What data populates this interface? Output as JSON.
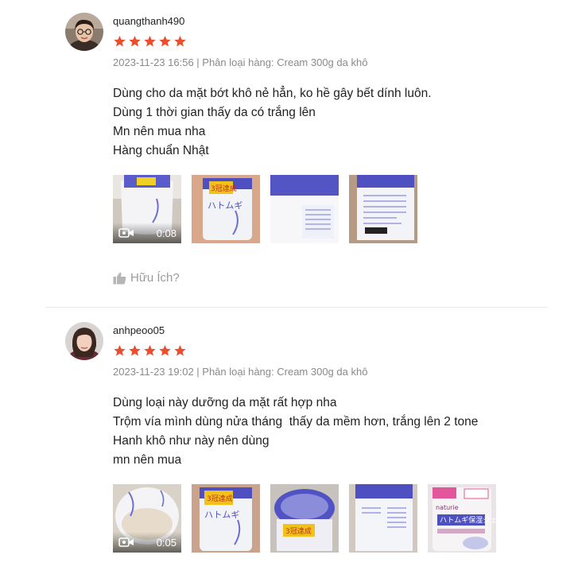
{
  "colors": {
    "star": "#ee4d2d",
    "meta": "#8a8a8a",
    "helpful": "#9a9a9a"
  },
  "reviews": [
    {
      "username": "quangthanh490",
      "rating": 5,
      "meta": "2023-11-23 16:56 | Phân loại hàng: Cream 300g da khô",
      "lines": [
        "Dùng cho da mặt bớt khô nẻ hẳn, ko hề gây bết dính luôn.",
        "Dùng 1 thời gian thấy da có trắng lên",
        "Mn nên mua nha",
        "Hàng chuẩn Nhật"
      ],
      "video_duration": "0:08",
      "media_count": 4,
      "helpful_label": "Hữu Ích?"
    },
    {
      "username": "anhpeoo05",
      "rating": 5,
      "meta": "2023-11-23 19:02 | Phân loại hàng: Cream 300g da khô",
      "lines": [
        "Dùng loại này dưỡng da mặt rất hợp nha",
        "Trộm vía mình dùng nửa tháng  thấy da mềm hơn, trắng lên 2 tone",
        "Hanh khô như này nên dùng",
        "mn nên mua"
      ],
      "video_duration": "0:05",
      "media_count": 5
    }
  ]
}
